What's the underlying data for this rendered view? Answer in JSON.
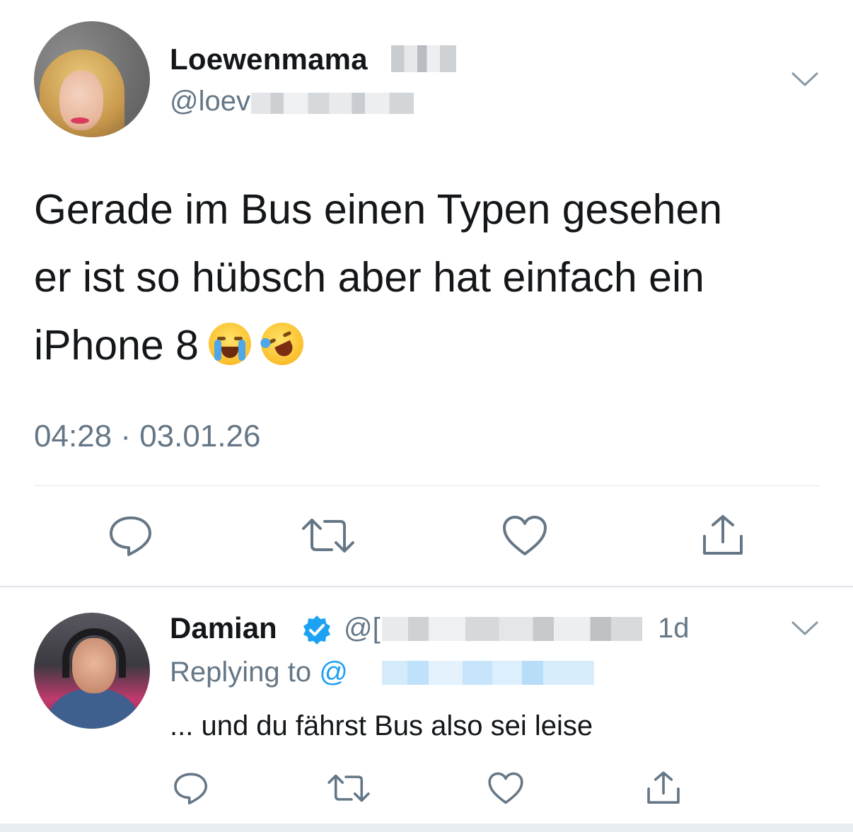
{
  "main_tweet": {
    "display_name": "Loewenmama",
    "handle": "@loev",
    "text_line1": "Gerade im Bus einen Typen gesehen",
    "text_line2": "er ist so hübsch aber hat einfach ein",
    "text_line3": "iPhone 8",
    "emojis": [
      "loudly-crying-face-icon",
      "rolling-on-floor-laughing-icon"
    ],
    "timestamp": "04:28 · 03.01.26",
    "actions": [
      "reply-icon",
      "retweet-icon",
      "like-icon",
      "share-icon"
    ]
  },
  "reply": {
    "display_name": "Damian",
    "verified": true,
    "handle": "@[",
    "time": "1d",
    "replying_to_label": "Replying to",
    "replying_to_mention": "@",
    "text": "... und du fährst Bus also sei leise",
    "actions": [
      "reply-icon",
      "retweet-icon",
      "like-icon",
      "share-icon"
    ]
  },
  "colors": {
    "text_primary": "#14171a",
    "text_secondary": "#657786",
    "link": "#1da1f2",
    "divider": "#e1e8ed"
  }
}
